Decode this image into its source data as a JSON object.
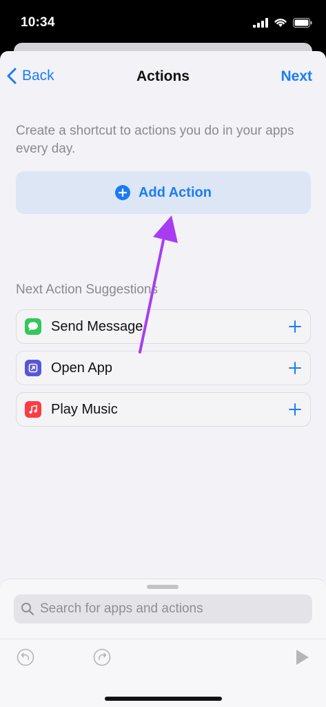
{
  "status_bar": {
    "time": "10:34"
  },
  "nav": {
    "back_label": "Back",
    "title": "Actions",
    "next_label": "Next"
  },
  "intro_text": "Create a shortcut to actions you do in your apps every day.",
  "add_action_label": "Add Action",
  "suggestions_header": "Next Action Suggestions",
  "suggestions": [
    {
      "label": "Send Message",
      "icon": "messages-icon",
      "icon_color": "#34c759"
    },
    {
      "label": "Open App",
      "icon": "open-app-icon",
      "icon_color": "#5856d6"
    },
    {
      "label": "Play Music",
      "icon": "music-icon",
      "icon_color": "#fc3c44"
    }
  ],
  "search": {
    "placeholder": "Search for apps and actions"
  },
  "colors": {
    "accent": "#1a7cf5",
    "annotation_arrow": "#a93cf2",
    "sheet_background": "#f2f2f7"
  }
}
